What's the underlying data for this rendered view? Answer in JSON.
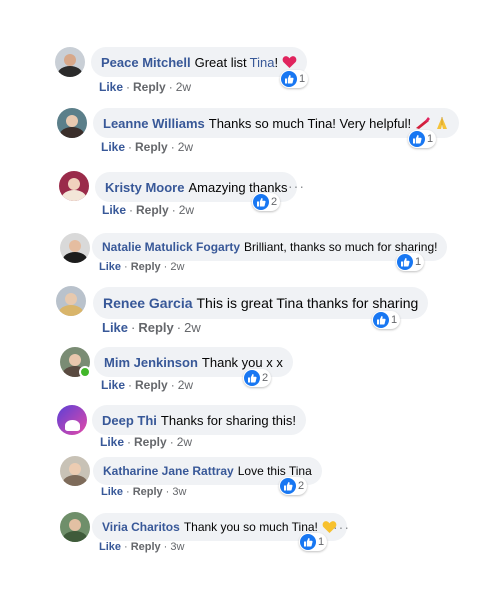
{
  "colors": {
    "link": "#385898",
    "bubble": "#f0f2f5",
    "meta": "#65676b",
    "like_badge": "#1877f2",
    "online": "#42b72a"
  },
  "icons": {
    "like": "like-badge-icon",
    "heart": "red-heart-emoji",
    "lipstick": "lipstick-emoji",
    "pray": "folded-hands-emoji",
    "yellow_heart": "yellow-heart-emoji",
    "more": "more-options-icon"
  },
  "actions": {
    "like_label": "Like",
    "reply_label": "Reply",
    "separator": "·"
  },
  "comments": [
    {
      "author": "Peace Mitchell",
      "text": "Great list",
      "mention": "Tina",
      "emoji": "!",
      "reactions": "1",
      "time": "2w"
    },
    {
      "author": "Leanne Williams",
      "text": "Thanks so much Tina! Very helpful!",
      "reactions": "1",
      "time": "2w"
    },
    {
      "author": "Kristy Moore",
      "text": "Amazying thanks",
      "reactions": "2",
      "time": "2w"
    },
    {
      "author": "Natalie Matulick Fogarty",
      "text": "Brilliant, thanks so much for sharing!",
      "reactions": "1",
      "time": "2w"
    },
    {
      "author": "Renee Garcia",
      "text": "This is great Tina thanks for sharing",
      "reactions": "1",
      "time": "2w"
    },
    {
      "author": "Mim Jenkinson",
      "text": "Thank you x x",
      "reactions": "2",
      "time": "2w"
    },
    {
      "author": "Deep Thi",
      "text": "Thanks for sharing this!",
      "time": "2w"
    },
    {
      "author": "Katharine Jane Rattray",
      "text": "Love this Tina",
      "reactions": "2",
      "time": "3w"
    },
    {
      "author": "Viria Charitos",
      "text": "Thank you so much Tina!",
      "reactions": "1",
      "time": "3w"
    }
  ]
}
